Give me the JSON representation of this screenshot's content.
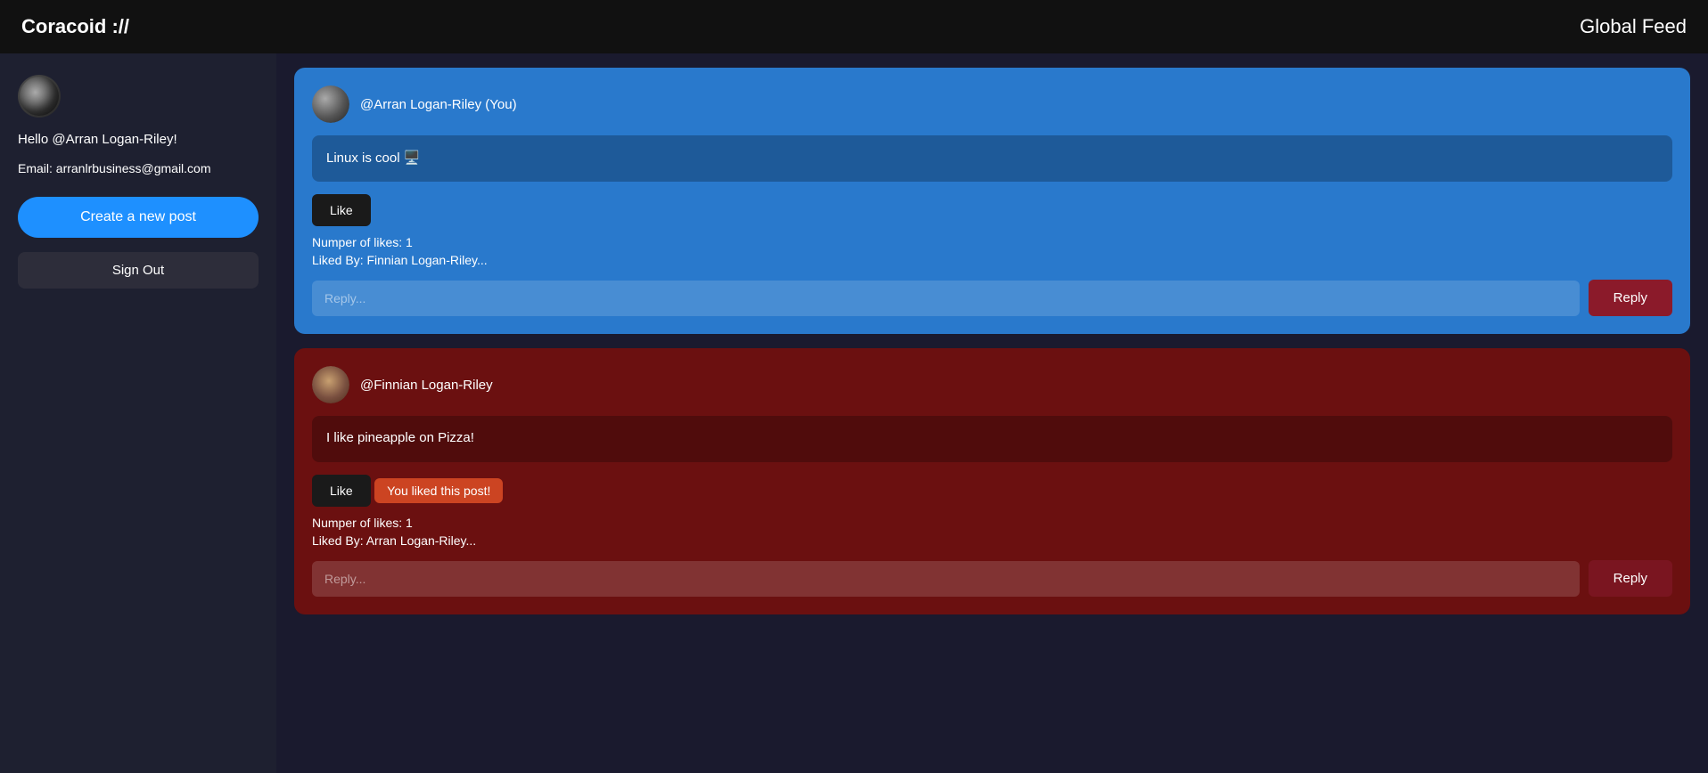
{
  "header": {
    "title": "Coracoid ://",
    "global_feed_label": "Global Feed"
  },
  "sidebar": {
    "greeting": "Hello @Arran Logan-Riley!",
    "email": "Email: arranlrbusiness@gmail.com",
    "create_button_label": "Create a new post",
    "signout_button_label": "Sign Out"
  },
  "posts": [
    {
      "id": "post-1",
      "username": "@Arran Logan-Riley (You)",
      "content": "Linux is cool 🖥️",
      "like_button_label": "Like",
      "liked_badge": null,
      "likes_count": "Numper of likes: 1",
      "liked_by": "Liked By: Finnian Logan-Riley...",
      "reply_placeholder": "Reply...",
      "reply_button_label": "Reply",
      "card_type": "blue"
    },
    {
      "id": "post-2",
      "username": "@Finnian Logan-Riley",
      "content": "I like pineapple on Pizza!",
      "like_button_label": "Like",
      "liked_badge": "You liked this post!",
      "likes_count": "Numper of likes: 1",
      "liked_by": "Liked By: Arran Logan-Riley...",
      "reply_placeholder": "Reply...",
      "reply_button_label": "Reply",
      "card_type": "red"
    }
  ]
}
